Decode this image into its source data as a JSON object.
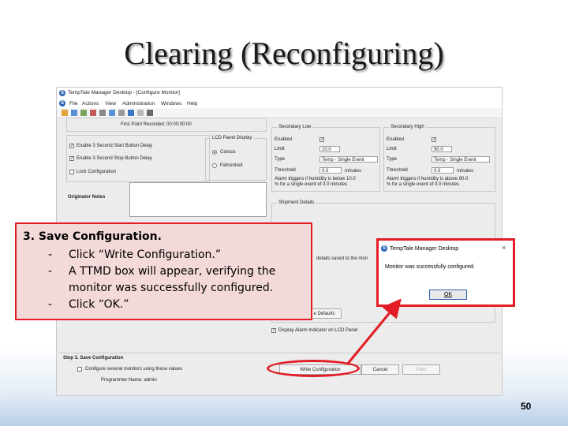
{
  "slide": {
    "title": "Clearing (Reconfiguring)",
    "page_number": "50"
  },
  "app": {
    "window_title": "TempTale Manager Desktop - [Configure Monitor]",
    "menu": [
      "File",
      "Actions",
      "View",
      "Administration",
      "Windows",
      "Help"
    ],
    "first_point": "First Point Recorded:  00:00:00:00",
    "options": {
      "enable_start": "Enable 3 Second Start Button Delay",
      "enable_stop": "Enable 3 Second Stop Button Delay",
      "lock_config": "Lock Configuration",
      "originator_notes": "Originator Notes"
    },
    "lcd": {
      "title": "LCD Panel Display",
      "celsius": "Celsius",
      "fahrenheit": "Fahrenheit"
    },
    "secondary_low": {
      "title": "Secondary Low",
      "enabled": "Enabled",
      "limit_label": "Limit",
      "limit_value": "10.0",
      "type_label": "Type",
      "type_value": "Temp - Single Event",
      "threshold_label": "Threshold",
      "threshold_value": "0.0",
      "threshold_unit": "minutes",
      "note1": "Alarm triggers if humidity is below 10.0",
      "note2": "% for a single event of 0.0 minutes"
    },
    "secondary_high": {
      "title": "Secondary High",
      "enabled": "Enabled",
      "limit_label": "Limit",
      "limit_value": "90.0",
      "type_label": "Type",
      "type_value": "Temp - Single Event",
      "threshold_label": "Threshold",
      "threshold_value": "0.0",
      "threshold_unit": "minutes",
      "note1": "Alarm triggers if humidity is above 90.0",
      "note2": "% for a single event of 0.0 minutes"
    },
    "shipment": {
      "title": "Shipment Details",
      "saved_text": "details saved to the mon",
      "defaults_button": "e Defaults",
      "display_alarm": "Display Alarm Indicator on LCD Panel"
    },
    "step3": {
      "title": "Step 3. Save Configuration",
      "configure_several": "Configure several monitors using these values",
      "programmer": "Programmer Name:  admin",
      "write_button": "Write Configuration",
      "cancel_button": "Cancel",
      "print_button": "Print"
    }
  },
  "callout": {
    "step": "3.  Save Configuration.",
    "dash": "-",
    "line1": "Click “Write Configuration.”",
    "line2": "A TTMD box will appear, verifying the",
    "line3": "monitor was successfully configured.",
    "line4": "Click “OK.”"
  },
  "dialog": {
    "title": "TempTale Manager Desktop",
    "close": "×",
    "message": "Monitor was successfully configured.",
    "ok_button": "OK"
  },
  "colors": {
    "callout_border": "#e21d25",
    "callout_fill": "#f4d9d9",
    "arrow": "#e21d25"
  }
}
